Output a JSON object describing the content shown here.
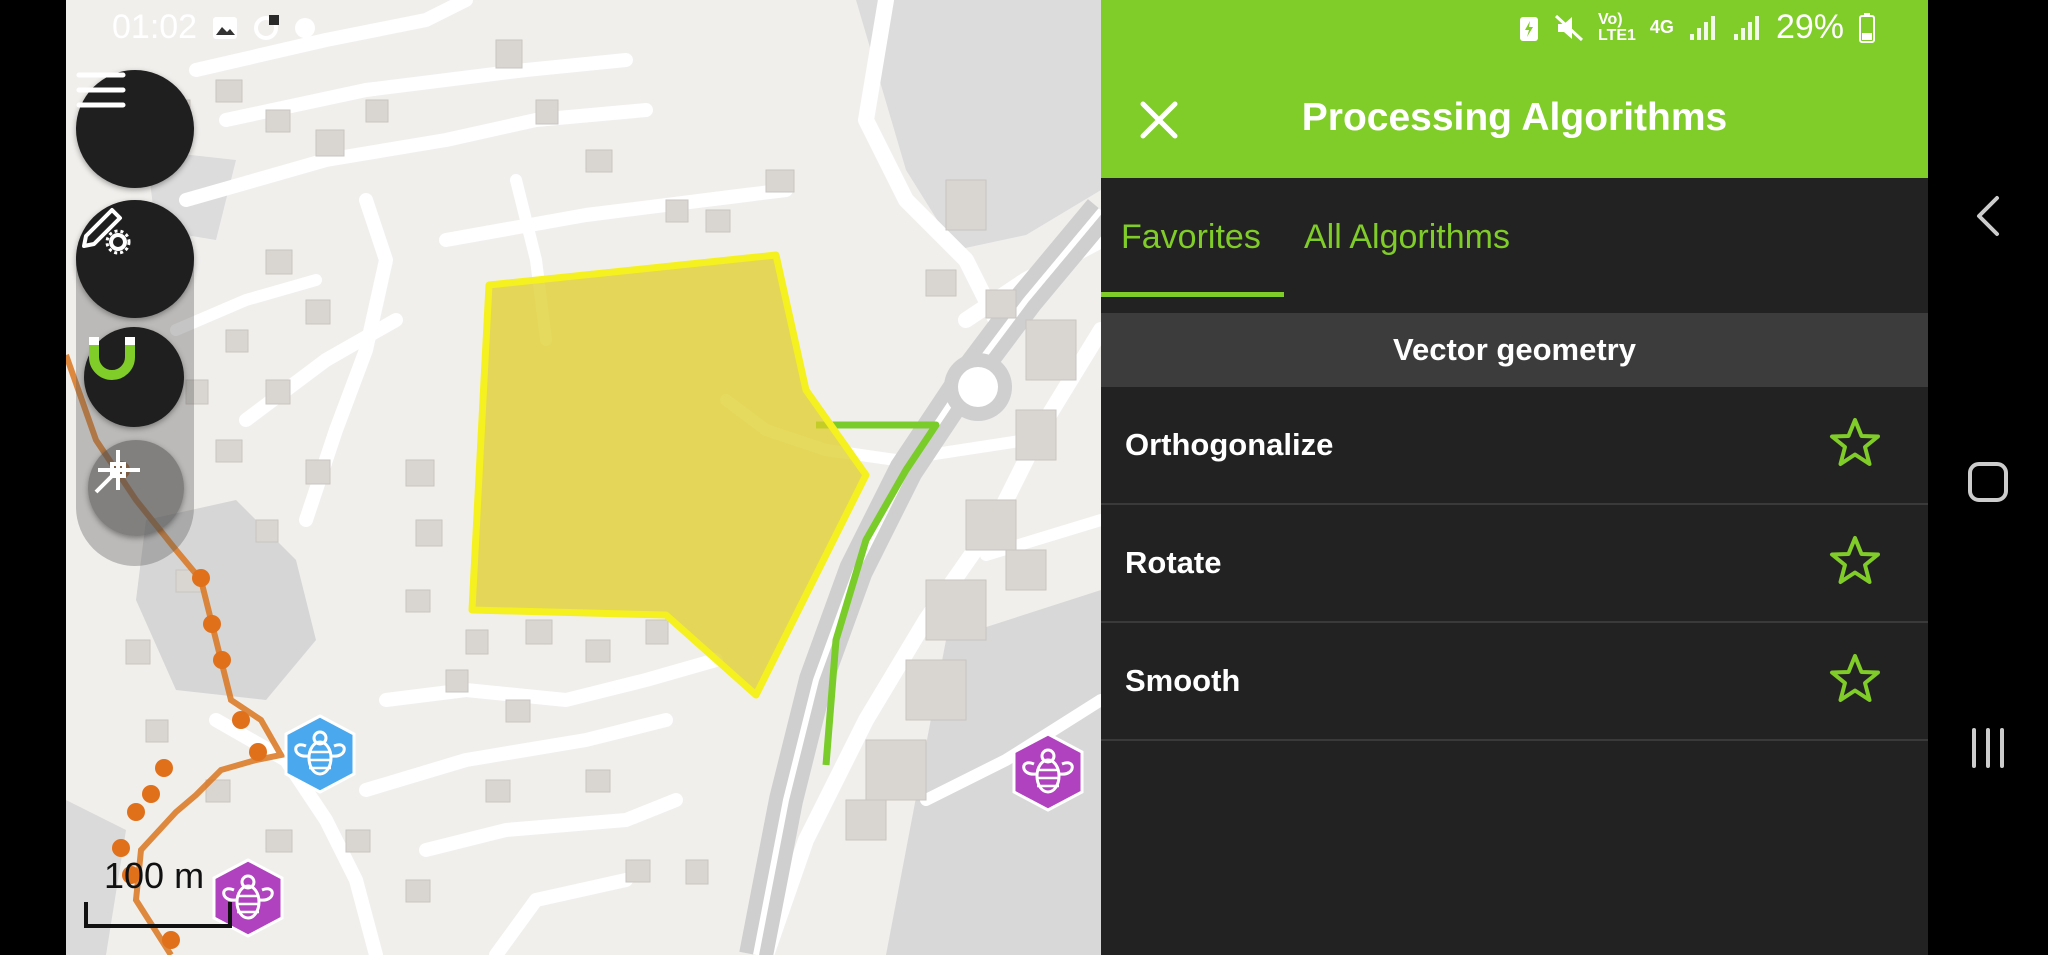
{
  "status_bar": {
    "time": "01:02",
    "battery": "29%",
    "network": "4G"
  },
  "map": {
    "scale_label": "100 m"
  },
  "panel": {
    "title": "Processing Algorithms",
    "tabs": [
      {
        "label": "Favorites"
      },
      {
        "label": "All Algorithms"
      }
    ],
    "section_header": "Vector geometry",
    "items": [
      {
        "label": "Orthogonalize"
      },
      {
        "label": "Rotate"
      },
      {
        "label": "Smooth"
      }
    ]
  },
  "colors": {
    "accent": "#80cc28",
    "polygon": "#f5f020",
    "panel_bg": "#222222",
    "route": "#d9761f"
  }
}
